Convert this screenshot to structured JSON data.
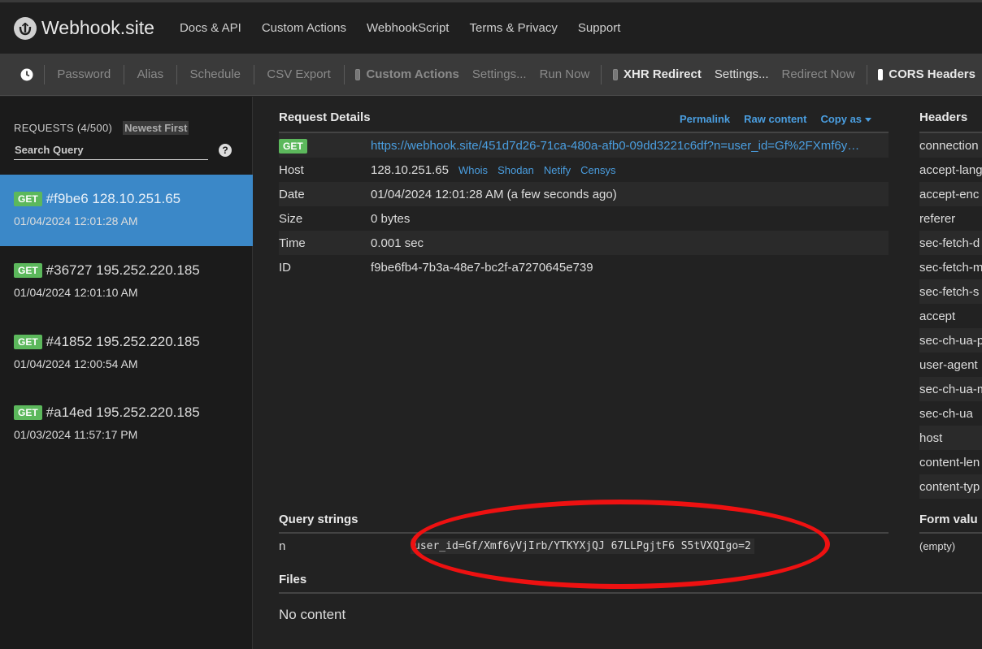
{
  "brand": {
    "name": "Webhook.site"
  },
  "nav": [
    "Docs & API",
    "Custom Actions",
    "WebhookScript",
    "Terms & Privacy",
    "Support"
  ],
  "toolbar": {
    "password": "Password",
    "alias": "Alias",
    "schedule": "Schedule",
    "csv_export": "CSV Export",
    "custom_actions": "Custom Actions",
    "ca_settings": "Settings...",
    "run_now": "Run Now",
    "xhr_redirect": "XHR Redirect",
    "xhr_settings": "Settings...",
    "redirect_now": "Redirect Now",
    "cors_headers": "CORS Headers"
  },
  "sidebar": {
    "requests_label": "REQUESTS (4/500)",
    "sort_label": "Newest First",
    "search_placeholder": "Search Query",
    "requests": [
      {
        "method": "GET",
        "title": "#f9be6 128.10.251.65",
        "date": "01/04/2024 12:01:28 AM"
      },
      {
        "method": "GET",
        "title": "#36727 195.252.220.185",
        "date": "01/04/2024 12:01:10 AM"
      },
      {
        "method": "GET",
        "title": "#41852 195.252.220.185",
        "date": "01/04/2024 12:00:54 AM"
      },
      {
        "method": "GET",
        "title": "#a14ed 195.252.220.185",
        "date": "01/03/2024 11:57:17 PM"
      }
    ]
  },
  "details": {
    "title": "Request Details",
    "links": {
      "permalink": "Permalink",
      "raw": "Raw content",
      "copy_as": "Copy as"
    },
    "method": "GET",
    "url": "https://webhook.site/451d7d26-71ca-480a-afb0-09dd3221c6df?n=user_id=Gf%2FXmf6y…",
    "host_label": "Host",
    "host": "128.10.251.65",
    "lookups": [
      "Whois",
      "Shodan",
      "Netify",
      "Censys"
    ],
    "date_label": "Date",
    "date": "01/04/2024 12:01:28 AM (a few seconds ago)",
    "size_label": "Size",
    "size": "0 bytes",
    "time_label": "Time",
    "time": "0.001 sec",
    "id_label": "ID",
    "id": "f9be6fb4-7b3a-48e7-bc2f-a7270645e739"
  },
  "headers": {
    "title": "Headers",
    "items": [
      "connection",
      "accept-lang",
      "accept-enc",
      "referer",
      "sec-fetch-d",
      "sec-fetch-m",
      "sec-fetch-s",
      "accept",
      "sec-ch-ua-p",
      "user-agent",
      "sec-ch-ua-m",
      "sec-ch-ua",
      "host",
      "content-len",
      "content-typ"
    ]
  },
  "query": {
    "title": "Query strings",
    "key": "n",
    "value": "user_id=Gf/Xmf6yVjIrb/YTKYXjQJ 67LLPgjtF6 S5tVXQIgo=2"
  },
  "form": {
    "title": "Form valu",
    "empty": "(empty)"
  },
  "files": {
    "title": "Files",
    "content": "No content"
  },
  "colors": {
    "accent": "#3b88c8",
    "get_badge": "#5cb85c",
    "link": "#4a9ee0",
    "highlight": "#ee1111"
  }
}
